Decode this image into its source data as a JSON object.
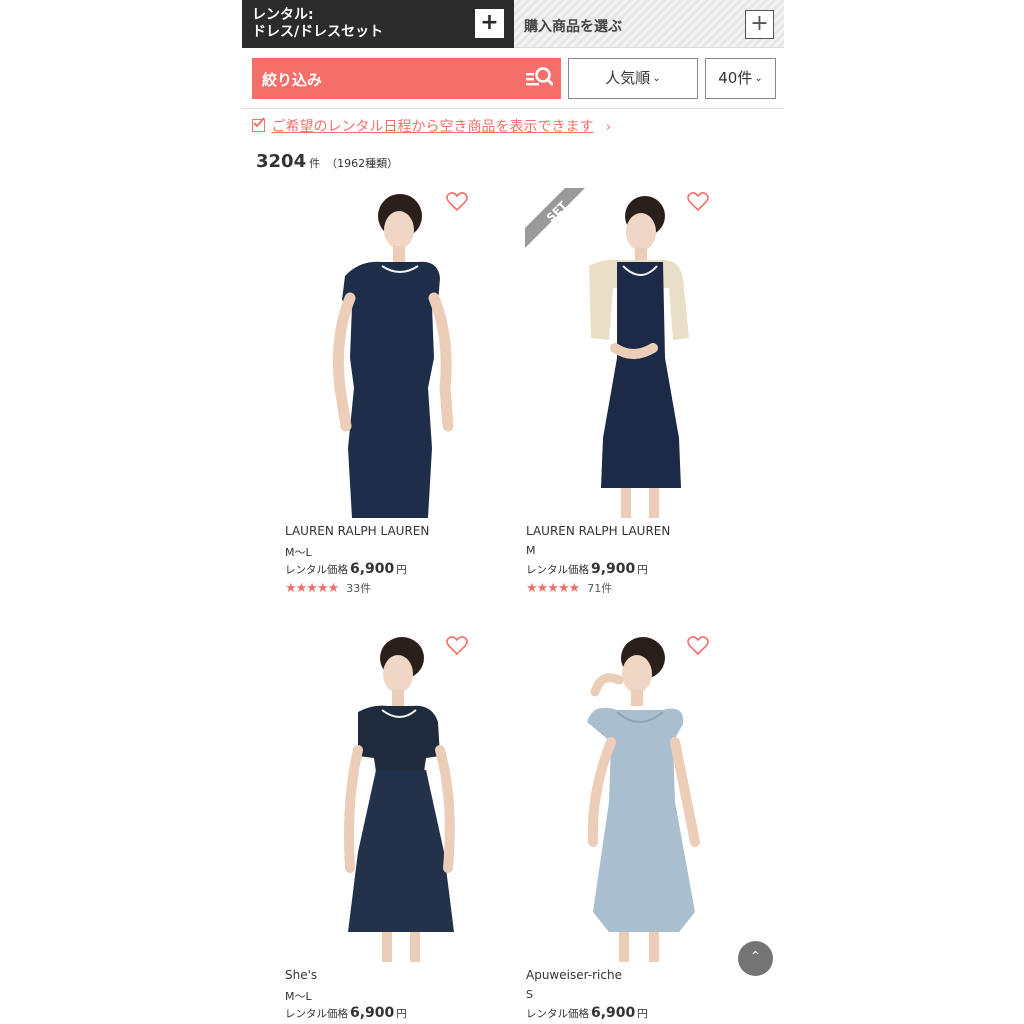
{
  "tabs": {
    "rental_label": "レンタル:\nドレス/ドレスセット",
    "buy_label": "購入商品を選ぶ",
    "plus": "+"
  },
  "filter": {
    "label": "絞り込み",
    "sort_label": "人気順",
    "count_label": "40件",
    "chevron": "⌄"
  },
  "notice": {
    "text": "ご希望のレンタル日程から空き商品を表示できます",
    "arrow": "›"
  },
  "results": {
    "total": "3204",
    "unit": "件",
    "kinds": "（1962種類）"
  },
  "products": [
    {
      "brand": "LAUREN RALPH LAUREN",
      "size": "M〜L",
      "price_prefix": "レンタル価格",
      "price": "6,900",
      "price_unit": "円",
      "stars": "★★★★★",
      "review_count": "33件",
      "set": false,
      "dress_color": "#1e2d4a"
    },
    {
      "brand": "LAUREN RALPH LAUREN",
      "size": "M",
      "price_prefix": "レンタル価格",
      "price": "9,900",
      "price_unit": "円",
      "stars": "★★★★★",
      "review_count": "71件",
      "set": true,
      "set_label": "SET",
      "dress_color": "#1c2a47"
    },
    {
      "brand": "She's",
      "size": "M〜L",
      "price_prefix": "レンタル価格",
      "price": "6,900",
      "price_unit": "円",
      "set": false,
      "dress_color": "#23314a"
    },
    {
      "brand": "Apuweiser-riche",
      "size": "S",
      "price_prefix": "レンタル価格",
      "price": "6,900",
      "price_unit": "円",
      "set": false,
      "dress_color": "#a9bfcf"
    }
  ],
  "colors": {
    "accent": "#f56f6a",
    "dark": "#2b2b2b"
  },
  "icons": {
    "to_top": "⌃"
  }
}
